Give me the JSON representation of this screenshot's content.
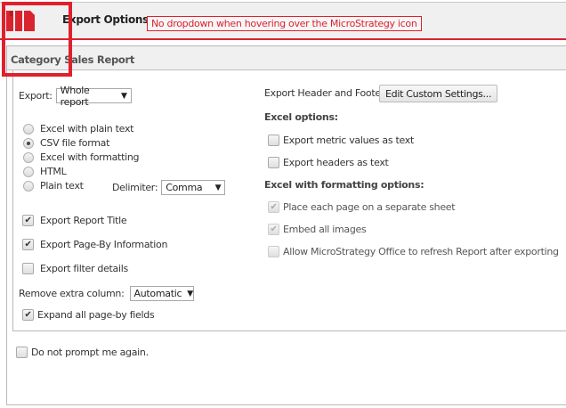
{
  "header": {
    "title": "Export Options",
    "annotation": "No dropdown when hovering over the MicroStrategy icon"
  },
  "report": {
    "title": "Category Sales Report"
  },
  "left": {
    "export_label": "Export:",
    "export_value": "Whole report",
    "formats": [
      {
        "label": "Excel with plain text",
        "selected": false
      },
      {
        "label": "CSV file format",
        "selected": true
      },
      {
        "label": "Excel with formatting",
        "selected": false
      },
      {
        "label": "HTML",
        "selected": false
      },
      {
        "label": "Plain text",
        "selected": false
      }
    ],
    "delimiter_label": "Delimiter:",
    "delimiter_value": "Comma",
    "export_report_title": "Export Report Title",
    "export_page_by": "Export Page-By Information",
    "export_filter": "Export filter details",
    "remove_extra_label": "Remove extra column:",
    "remove_extra_value": "Automatic",
    "expand_page_by": "Expand all page-by fields"
  },
  "right": {
    "header_footer_label": "Export Header and Footer:",
    "edit_button": "Edit Custom Settings...",
    "excel_options": "Excel options:",
    "metric_text": "Export metric values as text",
    "headers_text": "Export headers as text",
    "excel_fmt_options": "Excel with formatting options:",
    "separate_sheet": "Place each page on a separate sheet",
    "embed_images": "Embed all images",
    "allow_refresh": "Allow MicroStrategy Office to refresh Report after exporting"
  },
  "footer": {
    "do_not_prompt": "Do not prompt me again."
  },
  "check_glyph": "✔"
}
